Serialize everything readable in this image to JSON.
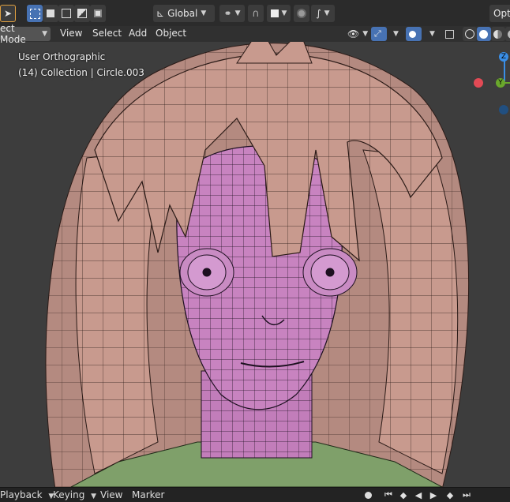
{
  "header": {
    "mode_label": "ect Mode",
    "menus": [
      "View",
      "Select",
      "Add",
      "Object"
    ],
    "transform_orientation": "Global",
    "options_label": "Opt"
  },
  "viewport": {
    "view_name": "User Orthographic",
    "collection_info": "(14) Collection | Circle.003",
    "gizmo": {
      "z_label": "Z",
      "y_label": "Y"
    }
  },
  "timeline": {
    "playback_label": "Playback",
    "keying_label": "Keying",
    "view_label": "View",
    "marker_label": "Marker"
  },
  "colors": {
    "accent": "#4772b3",
    "hair": "#c89a8e",
    "skin": "#c883c0",
    "axis_x": "#e24a55",
    "axis_y": "#6aa82c",
    "axis_z": "#3a8ee6"
  }
}
